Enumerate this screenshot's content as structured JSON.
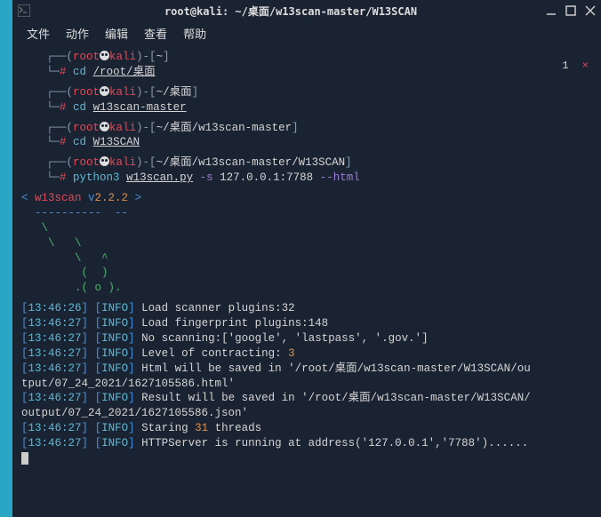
{
  "titlebar": {
    "title": "root@kali: ~/桌面/w13scan-master/W13SCAN"
  },
  "menubar": {
    "file": "文件",
    "actions": "动作",
    "edit": "编辑",
    "view": "查看",
    "help": "帮助"
  },
  "tab_indicator": {
    "num": "1",
    "close": "×"
  },
  "prompts": [
    {
      "user": "root",
      "host": "kali",
      "path": "~",
      "cmd_prefix": "cd",
      "cmd_arg": "/root/桌面"
    },
    {
      "user": "root",
      "host": "kali",
      "path": "~/桌面",
      "cmd_prefix": "cd",
      "cmd_arg": "w13scan-master"
    },
    {
      "user": "root",
      "host": "kali",
      "path": "~/桌面/w13scan-master",
      "cmd_prefix": "cd",
      "cmd_arg": "W13SCAN"
    },
    {
      "user": "root",
      "host": "kali",
      "path": "~/桌面/w13scan-master/W13SCAN",
      "cmd_prefix": "python3",
      "cmd_arg": "w13scan.py",
      "flag1": "-s",
      "flag1_arg": "127.0.0.1:7788",
      "flag2": "--html"
    }
  ],
  "banner": {
    "line1_a": "< ",
    "line1_b": "w13scan",
    "line1_c": " v",
    "line1_d": "2.2.2",
    "line1_e": " >",
    "line2": "  ----------  --",
    "art1": "   \\",
    "art2": "    \\   \\",
    "art3": "        \\   ^",
    "art4": "         (  )",
    "art5": "        .( o )."
  },
  "logs": [
    {
      "time": "13:46:26",
      "level": "INFO",
      "msg_a": "Load scanner plugins:32"
    },
    {
      "time": "13:46:27",
      "level": "INFO",
      "msg_a": "Load fingerprint plugins:148"
    },
    {
      "time": "13:46:27",
      "level": "INFO",
      "msg_a": "No scanning:['google', 'lastpass', '.gov.']"
    },
    {
      "time": "13:46:27",
      "level": "INFO",
      "msg_a": "Level of contracting: ",
      "msg_num": "3"
    },
    {
      "time": "13:46:27",
      "level": "INFO",
      "msg_a": "Html will be saved in '/root/桌面/w13scan-master/W13SCAN/ou",
      "msg_b": "tput/07_24_2021/1627105586.html'"
    },
    {
      "time": "13:46:27",
      "level": "INFO",
      "msg_a": "Result will be saved in '/root/桌面/w13scan-master/W13SCAN/",
      "msg_b": "output/07_24_2021/1627105586.json'"
    },
    {
      "time": "13:46:27",
      "level": "INFO",
      "msg_a": "Staring ",
      "msg_num": "31",
      "msg_c": " threads"
    },
    {
      "time": "13:46:27",
      "level": "INFO",
      "msg_a": "HTTPServer is running at address('127.0.0.1','7788')......"
    }
  ]
}
